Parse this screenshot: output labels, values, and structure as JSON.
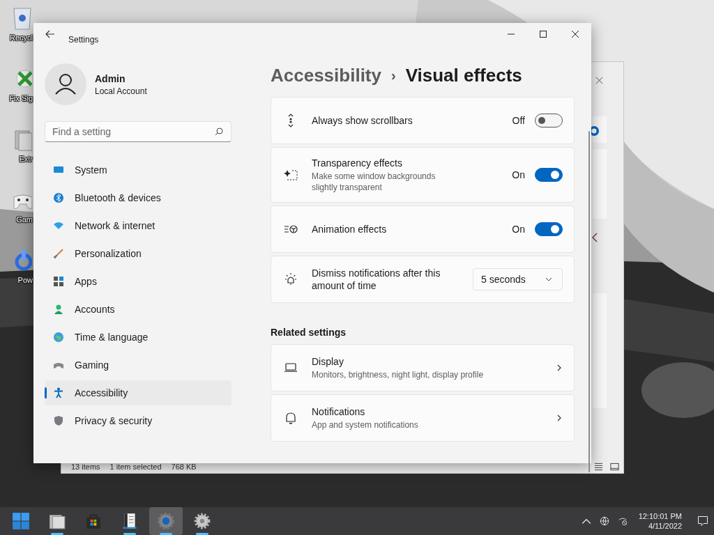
{
  "desktop_icons": [
    {
      "label": "Recycl"
    },
    {
      "label": "Fix Sig"
    },
    {
      "label": "Extr"
    },
    {
      "label": "Gam"
    },
    {
      "label": "Pow"
    }
  ],
  "background_window": {
    "status_items": "13 items",
    "status_selection": "1 item selected",
    "status_size": "768 KB"
  },
  "window": {
    "title": "Settings"
  },
  "account": {
    "name": "Admin",
    "type": "Local Account"
  },
  "search": {
    "placeholder": "Find a setting"
  },
  "nav": [
    {
      "label": "System",
      "selected": false
    },
    {
      "label": "Bluetooth & devices",
      "selected": false
    },
    {
      "label": "Network & internet",
      "selected": false
    },
    {
      "label": "Personalization",
      "selected": false
    },
    {
      "label": "Apps",
      "selected": false
    },
    {
      "label": "Accounts",
      "selected": false
    },
    {
      "label": "Time & language",
      "selected": false
    },
    {
      "label": "Gaming",
      "selected": false
    },
    {
      "label": "Accessibility",
      "selected": true
    },
    {
      "label": "Privacy & security",
      "selected": false
    }
  ],
  "breadcrumb": {
    "parent": "Accessibility",
    "separator": "›",
    "current": "Visual effects"
  },
  "settings": [
    {
      "kind": "toggle",
      "title": "Always show scrollbars",
      "state_label": "Off",
      "on": false
    },
    {
      "kind": "toggle",
      "title": "Transparency effects",
      "description": "Make some window backgrounds slightly transparent",
      "state_label": "On",
      "on": true
    },
    {
      "kind": "toggle",
      "title": "Animation effects",
      "state_label": "On",
      "on": true
    },
    {
      "kind": "dropdown",
      "title": "Dismiss notifications after this amount of time",
      "value": "5 seconds"
    }
  ],
  "related": {
    "heading": "Related settings",
    "items": [
      {
        "title": "Display",
        "description": "Monitors, brightness, night light, display profile"
      },
      {
        "title": "Notifications",
        "description": "App and system notifications"
      }
    ]
  },
  "taskbar": {
    "apps": [
      {
        "running": false,
        "selected": false
      },
      {
        "running": true,
        "selected": false
      },
      {
        "running": false,
        "selected": false
      },
      {
        "running": true,
        "selected": false
      },
      {
        "running": true,
        "selected": true
      },
      {
        "running": true,
        "selected": false
      }
    ],
    "time": "12:10:01 PM",
    "date": "4/11/2022"
  }
}
